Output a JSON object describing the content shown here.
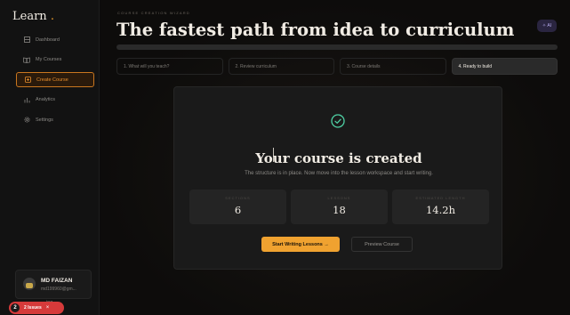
{
  "app": {
    "brand": "Learn",
    "brand_dot": "."
  },
  "sidebar": {
    "items": [
      {
        "label": "Dashboard",
        "icon": "dashboard-icon"
      },
      {
        "label": "My Courses",
        "icon": "book-icon"
      },
      {
        "label": "Create Course",
        "icon": "create-icon",
        "active": true
      },
      {
        "label": "Analytics",
        "icon": "bar-chart-icon"
      },
      {
        "label": "Settings",
        "icon": "gear-icon"
      }
    ]
  },
  "user": {
    "name": "MD FAIZAN",
    "email": "md199960@gm...",
    "extra": "ing",
    "initials": "MD"
  },
  "issues": {
    "count": "2",
    "label": "2 Issues",
    "close": "×"
  },
  "header": {
    "wizard_label": "COURSE CREATION WIZARD",
    "title": "The fastest path from idea to curriculum",
    "ai_label": "AI"
  },
  "steps": [
    {
      "label": "1. What will you teach?"
    },
    {
      "label": "2. Review curriculum"
    },
    {
      "label": "3. Course details"
    },
    {
      "label": "4. Ready to build",
      "current": true
    }
  ],
  "result": {
    "title": "Your course is created",
    "subtitle": "The structure is in place. Now move into the lesson workspace and start writing.",
    "stats": [
      {
        "label": "SECTIONS",
        "value": "6"
      },
      {
        "label": "LESSONS",
        "value": "18"
      },
      {
        "label": "ESTIMATED LENGTH",
        "value": "14.2h"
      }
    ],
    "primary_button": "Start Writing Lessons →",
    "secondary_button": "Preview Course"
  },
  "colors": {
    "accent": "#f0a230",
    "active_nav": "#e98f2e",
    "success": "#4fd1a5",
    "issues": "#d53a3a"
  }
}
